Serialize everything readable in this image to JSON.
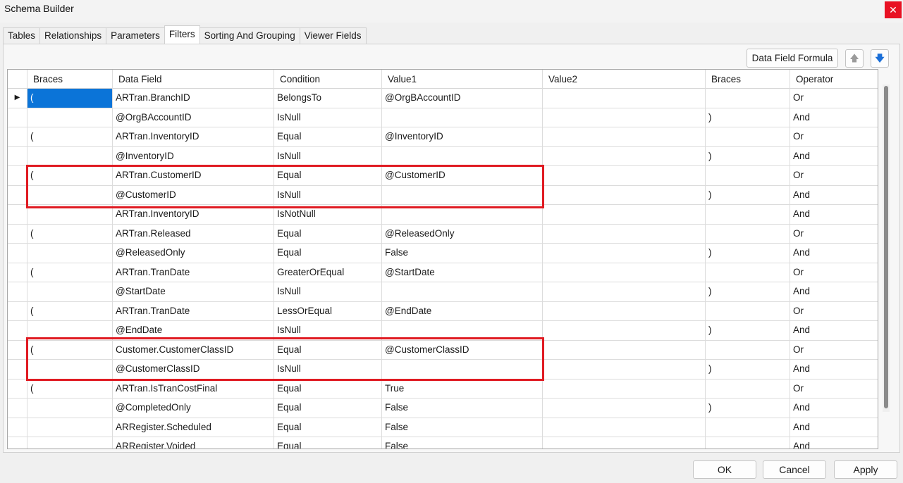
{
  "window": {
    "title": "Schema Builder",
    "close_glyph": "✕"
  },
  "tabs": [
    {
      "label": "Tables"
    },
    {
      "label": "Relationships"
    },
    {
      "label": "Parameters"
    },
    {
      "label": "Filters",
      "active": true
    },
    {
      "label": "Sorting And Grouping"
    },
    {
      "label": "Viewer Fields"
    }
  ],
  "toolbar": {
    "formula_button": "Data Field Formula",
    "up_icon": "arrow-up-icon",
    "down_icon": "arrow-down-icon"
  },
  "grid": {
    "columns": [
      "",
      "Braces",
      "Data Field",
      "Condition",
      "Value1",
      "Value2",
      "Braces",
      "Operator"
    ],
    "rows": [
      [
        "▶",
        "(",
        "ARTran.BranchID",
        "BelongsTo",
        "@OrgBAccountID",
        "",
        "",
        "Or"
      ],
      [
        "",
        "",
        "@OrgBAccountID",
        "IsNull",
        "",
        "",
        ")",
        "And"
      ],
      [
        "",
        "(",
        "ARTran.InventoryID",
        "Equal",
        "@InventoryID",
        "",
        "",
        "Or"
      ],
      [
        "",
        "",
        "@InventoryID",
        "IsNull",
        "",
        "",
        ")",
        "And"
      ],
      [
        "",
        "(",
        "ARTran.CustomerID",
        "Equal",
        "@CustomerID",
        "",
        "",
        "Or"
      ],
      [
        "",
        "",
        "@CustomerID",
        "IsNull",
        "",
        "",
        ")",
        "And"
      ],
      [
        "",
        "",
        "ARTran.InventoryID",
        "IsNotNull",
        "",
        "",
        "",
        "And"
      ],
      [
        "",
        "(",
        "ARTran.Released",
        "Equal",
        "@ReleasedOnly",
        "",
        "",
        "Or"
      ],
      [
        "",
        "",
        "@ReleasedOnly",
        "Equal",
        "False",
        "",
        ")",
        "And"
      ],
      [
        "",
        "(",
        "ARTran.TranDate",
        "GreaterOrEqual",
        "@StartDate",
        "",
        "",
        "Or"
      ],
      [
        "",
        "",
        "@StartDate",
        "IsNull",
        "",
        "",
        ")",
        "And"
      ],
      [
        "",
        "(",
        "ARTran.TranDate",
        "LessOrEqual",
        "@EndDate",
        "",
        "",
        "Or"
      ],
      [
        "",
        "",
        "@EndDate",
        "IsNull",
        "",
        "",
        ")",
        "And"
      ],
      [
        "",
        "(",
        "Customer.CustomerClassID",
        "Equal",
        "@CustomerClassID",
        "",
        "",
        "Or"
      ],
      [
        "",
        "",
        "@CustomerClassID",
        "IsNull",
        "",
        "",
        ")",
        "And"
      ],
      [
        "",
        "(",
        "ARTran.IsTranCostFinal",
        "Equal",
        "True",
        "",
        "",
        "Or"
      ],
      [
        "",
        "",
        "@CompletedOnly",
        "Equal",
        "False",
        "",
        ")",
        "And"
      ],
      [
        "",
        "",
        "ARRegister.Scheduled",
        "Equal",
        "False",
        "",
        "",
        "And"
      ],
      [
        "",
        "",
        "ARRegister.Voided",
        "Equal",
        "False",
        "",
        "",
        "And"
      ]
    ]
  },
  "footer": {
    "ok": "OK",
    "cancel": "Cancel",
    "apply": "Apply"
  },
  "colors": {
    "highlight": "#e01b22",
    "selection": "#0b74d8"
  }
}
